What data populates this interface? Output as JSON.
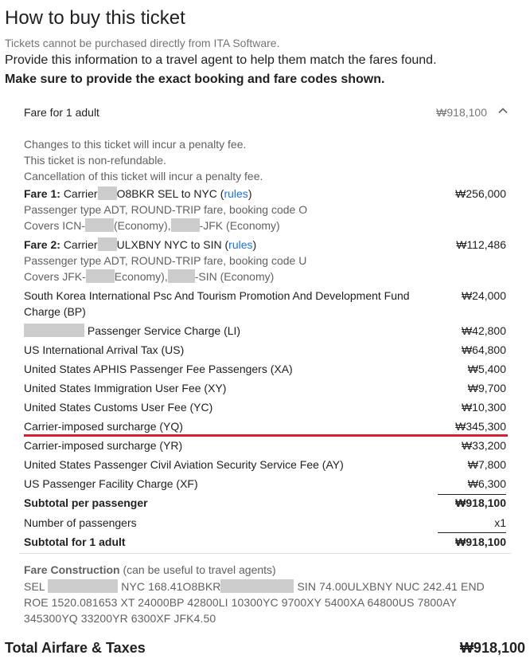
{
  "header": {
    "title": "How to buy this ticket",
    "note_cannot_purchase": "Tickets cannot be purchased directly from ITA Software.",
    "note_provide": "Provide this information to a travel agent to help them match the fares found.",
    "note_exact": "Make sure to provide the exact booking and fare codes shown."
  },
  "fare_card": {
    "heading": "Fare for 1 adult",
    "heading_amount": "₩918,100",
    "expand_icon": "chevron-up-icon",
    "rules": [
      "Changes to this ticket will incur a penalty fee.",
      "This ticket is non-refundable.",
      "Cancellation of this ticket will incur a penalty fee."
    ],
    "fare1": {
      "label": "Fare 1:",
      "carrier_prefix": "Carrier",
      "route": "O8BKR SEL to NYC (",
      "rules_link": "rules",
      "route_close": ")",
      "amount": "₩256,000",
      "passenger_line": "Passenger type ADT, ROUND-TRIP fare, booking code O",
      "covers_prefix": "Covers ICN-",
      "covers_mid": "(Economy),",
      "covers_end": "-JFK (Economy)"
    },
    "fare2": {
      "label": "Fare 2:",
      "carrier_prefix": "Carrier",
      "route": "ULXBNY NYC to SIN (",
      "rules_link": "rules",
      "route_close": ")",
      "amount": "₩112,486",
      "passenger_line": "Passenger type ADT, ROUND-TRIP fare, booking code U",
      "covers_prefix": "Covers JFK-",
      "covers_mid": "Economy),",
      "covers_end": "-SIN (Economy)"
    },
    "taxes": [
      {
        "label": "South Korea International Psc And Tourism Promotion And Development Fund Charge (BP)",
        "amount": "₩24,000"
      },
      {
        "label": "Passenger Service Charge (LI)",
        "amount": "₩42,800"
      },
      {
        "label": "US International Arrival Tax (US)",
        "amount": "₩64,800"
      },
      {
        "label": "United States APHIS Passenger Fee Passengers (XA)",
        "amount": "₩5,400"
      },
      {
        "label": "United States Immigration User Fee (XY)",
        "amount": "₩9,700"
      },
      {
        "label": "United States Customs User Fee (YC)",
        "amount": "₩10,300"
      },
      {
        "label": "Carrier-imposed surcharge (YQ)",
        "amount": "₩345,300"
      },
      {
        "label": "Carrier-imposed surcharge (YR)",
        "amount": "₩33,200"
      },
      {
        "label": "United States Passenger Civil Aviation Security Service Fee (AY)",
        "amount": "₩7,800"
      },
      {
        "label": "US Passenger Facility Charge (XF)",
        "amount": "₩6,300"
      }
    ],
    "subtotal_per_passenger": {
      "label": "Subtotal per passenger",
      "amount": "₩918,100"
    },
    "num_passengers": {
      "label": "Number of passengers",
      "amount": "x1"
    },
    "subtotal_adult": {
      "label": "Subtotal for 1 adult",
      "amount": "₩918,100"
    },
    "fare_construction": {
      "title": "Fare Construction",
      "title_note": "(can be useful to travel agents)",
      "seg1": "SEL",
      "seg2": "NYC 168.41O8BKR",
      "seg3": "SIN 74.00ULXBNY NUC 242.41 END ROE 1520.081653 XT 24000BP 42800LI 10300YC 9700XY 5400XA 64800US 7800AY 345300YQ 33200YR 6300XF JFK4.50"
    }
  },
  "total": {
    "label": "Total Airfare & Taxes",
    "amount": "₩918,100"
  },
  "colors": {
    "highlight_rule": "#d6232f",
    "link": "#1a73e8",
    "redaction": "#cccccc"
  }
}
